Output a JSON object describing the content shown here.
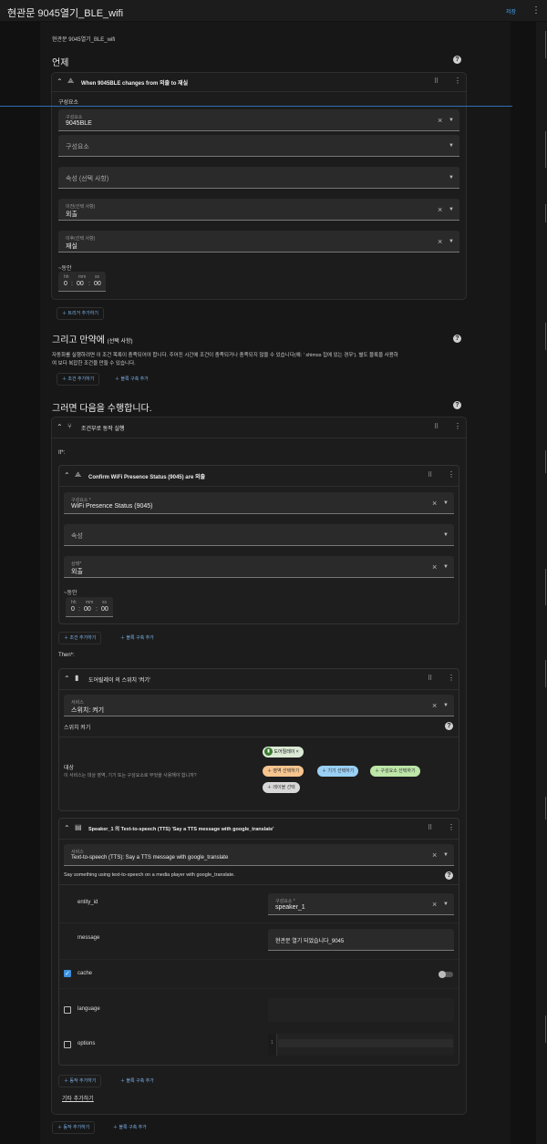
{
  "header": {
    "title": "현관문 9045열기_BLE_wifi",
    "save_label": "저장",
    "menu_icon": "⋮"
  },
  "page": {
    "name": "현관문 9045열기_BLE_wifi"
  },
  "trigger_section": {
    "title": "언제"
  },
  "trigger": {
    "summary": "When 9045BLE changes from 외출 to 재실",
    "entity_header": "구성요소",
    "entity": {
      "label": "구성요소",
      "value": "9045BLE"
    },
    "entity2": {
      "placeholder": "구성요소"
    },
    "attribute": {
      "placeholder": "속성 (선택 사항)"
    },
    "from": {
      "label": "이전(선택 사항)",
      "value": "외출"
    },
    "to": {
      "label": "이후(선택 사항)",
      "value": "재실"
    },
    "for_label": "~동안",
    "duration": {
      "h_label": "hh",
      "m_label": "mm",
      "s_label": "ss",
      "h": "0",
      "m": "00",
      "s": "00"
    },
    "add_trigger": "트리거 추가하기"
  },
  "condition_section": {
    "title": "그리고 만약에",
    "optional": "(선택 사항)",
    "desc_line1": "자동화를 실행하려면 이 조건 목록이 충족되어야 합니다. 주어진 시간에 조건이 충족되거나 충족되지 않을 수 있습니다(예: ' shimss 집에 있는 경우'). 별도 블록을 사용하",
    "desc_line2": "여 보다 복잡한 조건을 만들 수 있습니다.",
    "add_condition": "조건 추가하기",
    "add_block": "블록 구축 추가"
  },
  "action_section": {
    "title": "그러면 다음을 수행합니다."
  },
  "choose_action": {
    "summary": "조건부로 동작 실행",
    "if_label": "If*:",
    "condition": {
      "summary": "Confirm WiFi Presence Status (9045) are 외출",
      "entity": {
        "label": "구성요소 *",
        "value": "WiFi Presence Status (9045)"
      },
      "attribute": {
        "placeholder": "속성"
      },
      "state": {
        "label": "상태*",
        "value": "외출"
      },
      "for_label": "~동안",
      "duration": {
        "h_label": "hh",
        "m_label": "mm",
        "s_label": "ss",
        "h": "0",
        "m": "00",
        "s": "00"
      },
      "add_condition": "조건 추가하기",
      "add_block": "블록 구축 추가"
    },
    "then_label": "Then*:",
    "switch_action": {
      "summary": "도어릴레이 의 스위치 '켜기'",
      "service": {
        "label": "서비스",
        "value": "스위치: 켜기"
      },
      "service_desc": "스위치 켜기",
      "target_label": "대상",
      "target_desc": "이 서비스는 대상 영역, 기기 또는 구성요소로 무엇을 사용해야 합니까?",
      "chip_entity": "도어릴레이",
      "chip_area": "영역 선택하기",
      "chip_device": "기기 선택하기",
      "chip_component": "구성요소 선택하기",
      "chip_label": "레이블 선택"
    },
    "tts_action": {
      "summary": "Speaker_1 의 Text-to-speech (TTS) 'Say a TTS message with google_translate'",
      "service": {
        "label": "서비스",
        "value": "Text-to-speech (TTS): Say a TTS message with google_translate"
      },
      "service_desc": "Say something using text-to-speech on a media player with google_translate.",
      "entity_id_label": "entity_id",
      "entity_id": {
        "label": "구성요소 *",
        "value": "speaker_1"
      },
      "message_label": "message",
      "message_value": "현관문 열기 되었습니다_9045",
      "cache_label": "cache",
      "language_label": "language",
      "options_label": "options",
      "options_line": "1"
    },
    "add_action": "동작 추가하기",
    "add_block": "블록 구축 추가",
    "else_link": "기타 추가하기"
  },
  "bottom": {
    "add_action": "동작 추가하기",
    "add_block": "블록 구축 추가"
  },
  "colors": {
    "accent": "#42a5f5",
    "background": "#111111",
    "card": "#1c1c1c",
    "chip_area": "#f8c58f",
    "chip_device": "#9ad0f5",
    "chip_component": "#bde6a8"
  }
}
